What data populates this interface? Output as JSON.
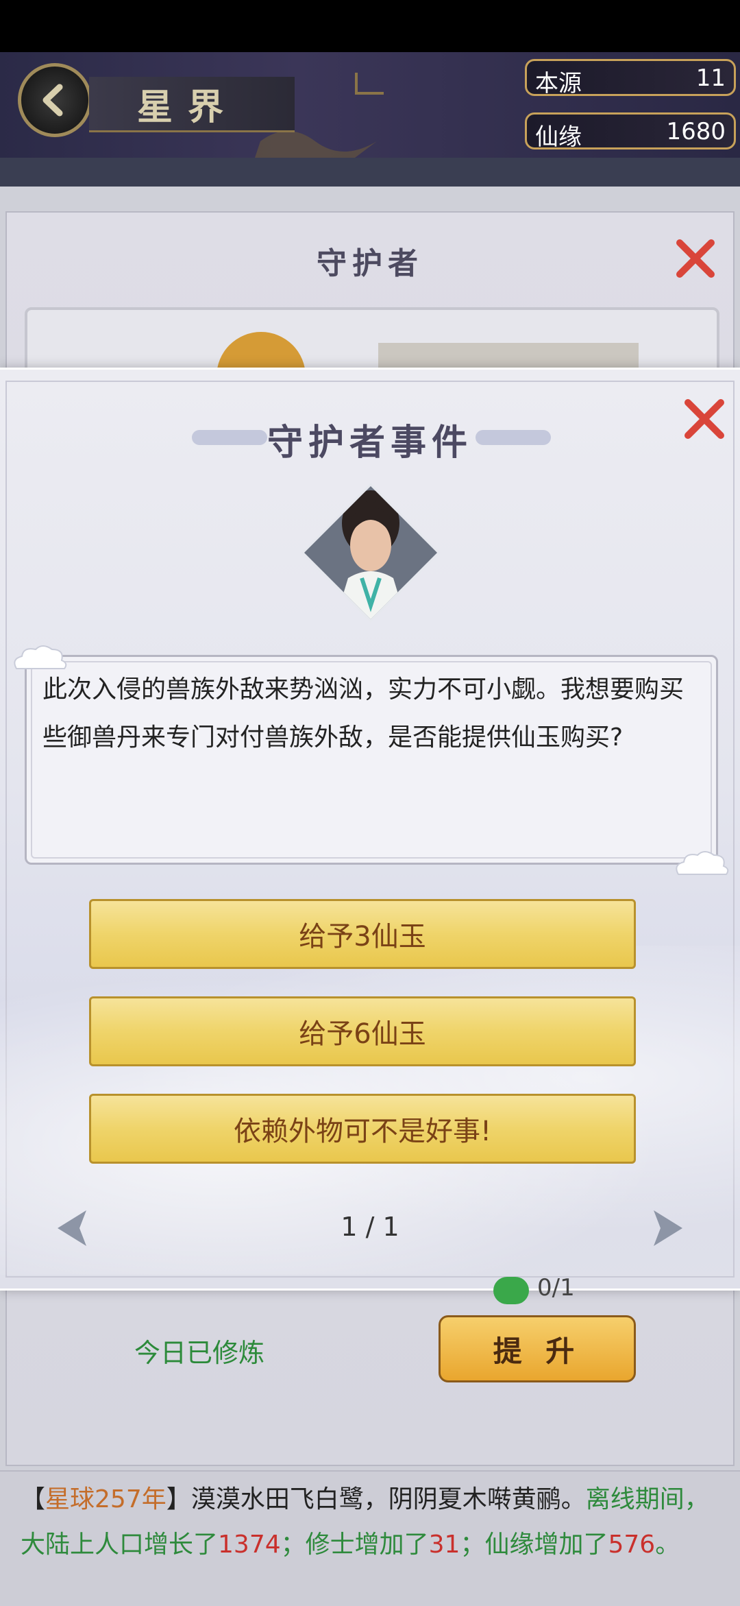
{
  "header": {
    "title": "星界",
    "resources": [
      {
        "label": "本源",
        "value": "11"
      },
      {
        "label": "仙缘",
        "value": "1680"
      }
    ]
  },
  "under_panel": {
    "title": "守护者",
    "progress": "0/1",
    "trained_today": "今日已修炼",
    "upgrade_label": "提 升"
  },
  "modal": {
    "title": "守护者事件",
    "dialog": "此次入侵的兽族外敌来势汹汹，实力不可小觑。我想要购买些御兽丹来专门对付兽族外敌，是否能提供仙玉购买?",
    "choices": [
      {
        "label": "给予3仙玉"
      },
      {
        "label": "给予6仙玉"
      },
      {
        "label": "依赖外物可不是好事!"
      }
    ],
    "pager": "1 / 1"
  },
  "log": {
    "open": "【",
    "year": "星球257年",
    "close": "】",
    "poem": "漠漠水田飞白鹭，阴阴夏木啭黄鹂。",
    "p1": "离线期间，大陆上人口增长了",
    "population": "1374",
    "p2": "；修士增加了",
    "cultivators": "31",
    "p3": "；仙缘增加了",
    "xianyuan": "576",
    "p4": "。"
  },
  "colors": {
    "accent_gold": "#efd46a",
    "close_red": "#d9453a",
    "green_text": "#2e8a3c"
  }
}
